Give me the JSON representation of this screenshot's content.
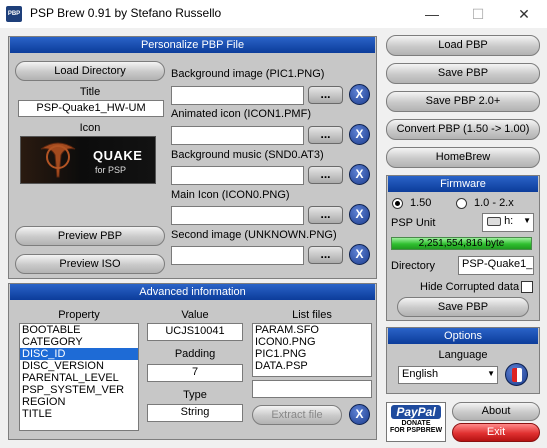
{
  "window": {
    "title": "PSP Brew 0.91  by Stefano Russello",
    "icon_text": "PBP",
    "min": "—",
    "max": "☐",
    "close": "✕"
  },
  "personalize": {
    "header": "Personalize PBP File",
    "load_directory": "Load Directory",
    "title_label": "Title",
    "title_value": "PSP-Quake1_HW-UM",
    "icon_label": "Icon",
    "icon_logo": "QUAKE",
    "icon_sub": "for PSP",
    "preview_pbp": "Preview PBP",
    "preview_iso": "Preview ISO",
    "fields": [
      {
        "label": "Background image (PIC1.PNG)",
        "value": "",
        "dots": "...",
        "x": "X"
      },
      {
        "label": "Animated icon (ICON1.PMF)",
        "value": "",
        "dots": "...",
        "x": "X"
      },
      {
        "label": "Background music (SND0.AT3)",
        "value": "",
        "dots": "...",
        "x": "X"
      },
      {
        "label": "Main Icon (ICON0.PNG)",
        "value": "",
        "dots": "...",
        "x": "X"
      },
      {
        "label": "Second image (UNKNOWN.PNG)",
        "value": "",
        "dots": "...",
        "x": "X"
      }
    ]
  },
  "advanced": {
    "header": "Advanced information",
    "property_label": "Property",
    "properties": [
      "BOOTABLE",
      "CATEGORY",
      "DISC_ID",
      "DISC_VERSION",
      "PARENTAL_LEVEL",
      "PSP_SYSTEM_VER",
      "REGION",
      "TITLE"
    ],
    "selected_index": 2,
    "value_label": "Value",
    "value": "UCJS10041",
    "padding_label": "Padding",
    "padding": "7",
    "type_label": "Type",
    "type": "String",
    "list_files_label": "List files",
    "files": [
      "PARAM.SFO",
      "ICON0.PNG",
      "PIC1.PNG",
      "DATA.PSP"
    ],
    "extract": "Extract file",
    "x": "X"
  },
  "actions": {
    "load_pbp": "Load PBP",
    "save_pbp": "Save PBP",
    "save_pbp2": "Save PBP 2.0+",
    "convert": "Convert PBP (1.50 -> 1.00)",
    "homebrew": "HomeBrew"
  },
  "firmware": {
    "header": "Firmware",
    "opt1": "1.50",
    "opt2": "1.0 - 2.x",
    "psp_unit_label": "PSP Unit",
    "drive": "h:",
    "bytes": "2,251,554,816 byte",
    "directory_label": "Directory",
    "directory": "PSP-Quake1_H",
    "hide_corrupted": "Hide Corrupted data",
    "save_pbp": "Save PBP"
  },
  "options": {
    "header": "Options",
    "language_label": "Language",
    "language": "English"
  },
  "footer": {
    "paypal": "PayPal",
    "donate1": "DONATE",
    "donate2": "FOR PSPBREW",
    "about": "About",
    "exit": "Exit"
  }
}
